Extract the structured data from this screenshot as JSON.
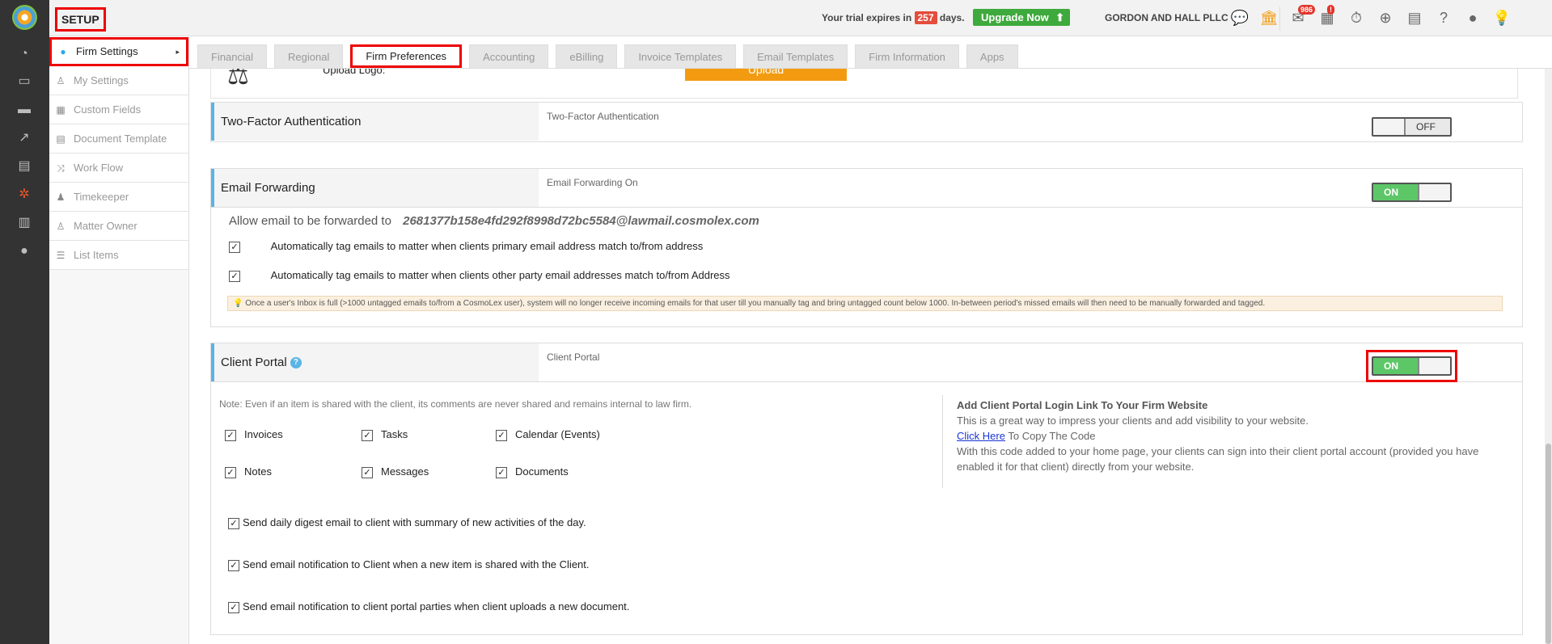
{
  "header": {
    "setup_label": "SETUP",
    "trial_prefix": "Your trial expires in",
    "trial_days": "257",
    "trial_suffix": "days.",
    "upgrade_label": "Upgrade Now",
    "firm_name": "GORDON AND HALL PLLC",
    "mail_count": "986",
    "calendar_badge": "!"
  },
  "leftbar": {
    "icons": [
      "dashboard-icon",
      "folder-icon",
      "laptop-icon",
      "chart-line-icon",
      "book-icon",
      "gears-icon",
      "bar-chart-icon",
      "user-icon"
    ]
  },
  "sidebar": {
    "items": [
      {
        "label": "Firm Settings",
        "icon": "circle-icon"
      },
      {
        "label": "My Settings",
        "icon": "user-icon"
      },
      {
        "label": "Custom Fields",
        "icon": "grid-icon"
      },
      {
        "label": "Document Template",
        "icon": "document-icon"
      },
      {
        "label": "Work Flow",
        "icon": "shuffle-icon"
      },
      {
        "label": "Timekeeper",
        "icon": "users-icon"
      },
      {
        "label": "Matter Owner",
        "icon": "user-icon"
      },
      {
        "label": "List Items",
        "icon": "list-icon"
      }
    ]
  },
  "tabs": [
    {
      "label": "Financial"
    },
    {
      "label": "Regional"
    },
    {
      "label": "Firm Preferences"
    },
    {
      "label": "Accounting"
    },
    {
      "label": "eBilling"
    },
    {
      "label": "Invoice Templates"
    },
    {
      "label": "Email Templates"
    },
    {
      "label": "Firm Information"
    },
    {
      "label": "Apps"
    }
  ],
  "upload": {
    "label": "Upload Logo:",
    "button": "Upload"
  },
  "two_factor": {
    "title": "Two-Factor Authentication",
    "desc": "Two-Factor Authentication",
    "toggle": "OFF"
  },
  "email_forwarding": {
    "title": "Email Forwarding",
    "desc": "Email Forwarding On",
    "toggle": "ON",
    "allow_label": "Allow email to be forwarded to",
    "address": "2681377b158e4fd292f8998d72bc5584@lawmail.cosmolex.com",
    "option1": "Automatically tag emails to matter when clients primary email address match to/from address",
    "option2": "Automatically tag emails to matter when clients other party email addresses match to/from Address",
    "note": "Once a user's Inbox is full (>1000 untagged emails to/from a CosmoLex user), system will no longer receive incoming emails for that user till you manually tag and bring untagged count below 1000. In-between period's missed emails will then need to be manually forwarded and tagged."
  },
  "client_portal": {
    "title": "Client Portal",
    "desc": "Client Portal",
    "toggle": "ON",
    "note": "Note: Even if an item is shared with the client, its comments are never shared and remains internal to law firm.",
    "items": [
      "Invoices",
      "Tasks",
      "Calendar (Events)",
      "Notes",
      "Messages",
      "Documents"
    ],
    "options": [
      "Send daily digest email to client with summary of new activities of the day.",
      "Send email notification to Client when a new item is shared with the Client.",
      "Send email notification to client portal parties when client uploads a new document."
    ],
    "right_heading": "Add Client Portal Login Link To Your Firm Website",
    "right_line1": "This is a great way to impress your clients and add visibility to your website.",
    "right_link": "Click Here",
    "right_link_suffix": " To Copy The Code",
    "right_line2": "With this code added to your home page, your clients can sign into their client portal account (provided you have enabled it for that client) directly from your website."
  }
}
